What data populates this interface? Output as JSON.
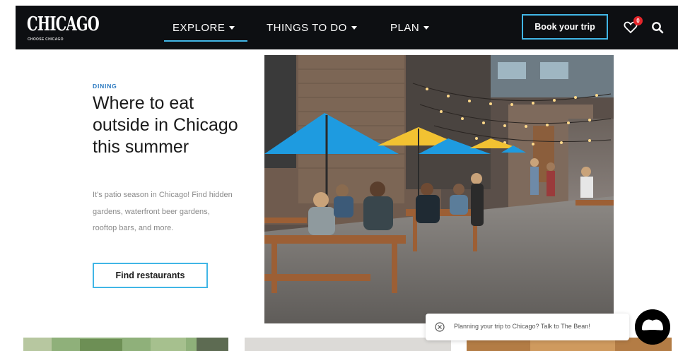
{
  "header": {
    "logo_main": "CHICAGO",
    "logo_sub": "CHOOSE CHICAGO",
    "nav": [
      {
        "label": "EXPLORE"
      },
      {
        "label": "THINGS TO DO"
      },
      {
        "label": "PLAN"
      }
    ],
    "book_label": "Book your trip",
    "favorites_count": "0",
    "icons": {
      "favorites": "heart-icon",
      "search": "search-icon"
    }
  },
  "article": {
    "eyebrow": "DINING",
    "title": "Where to eat outside in Chicago this summer",
    "description": "It's patio season in Chicago! Find hidden gardens, waterfront beer gardens, rooftop bars, and more.",
    "button_label": "Find restaurants"
  },
  "chat": {
    "text": "Planning your trip to Chicago? Talk to The Bean!"
  },
  "colors": {
    "header_bg": "#0d0f12",
    "accent": "#41b6e6",
    "eyebrow": "#2a79c0",
    "badge": "#e4262b"
  }
}
